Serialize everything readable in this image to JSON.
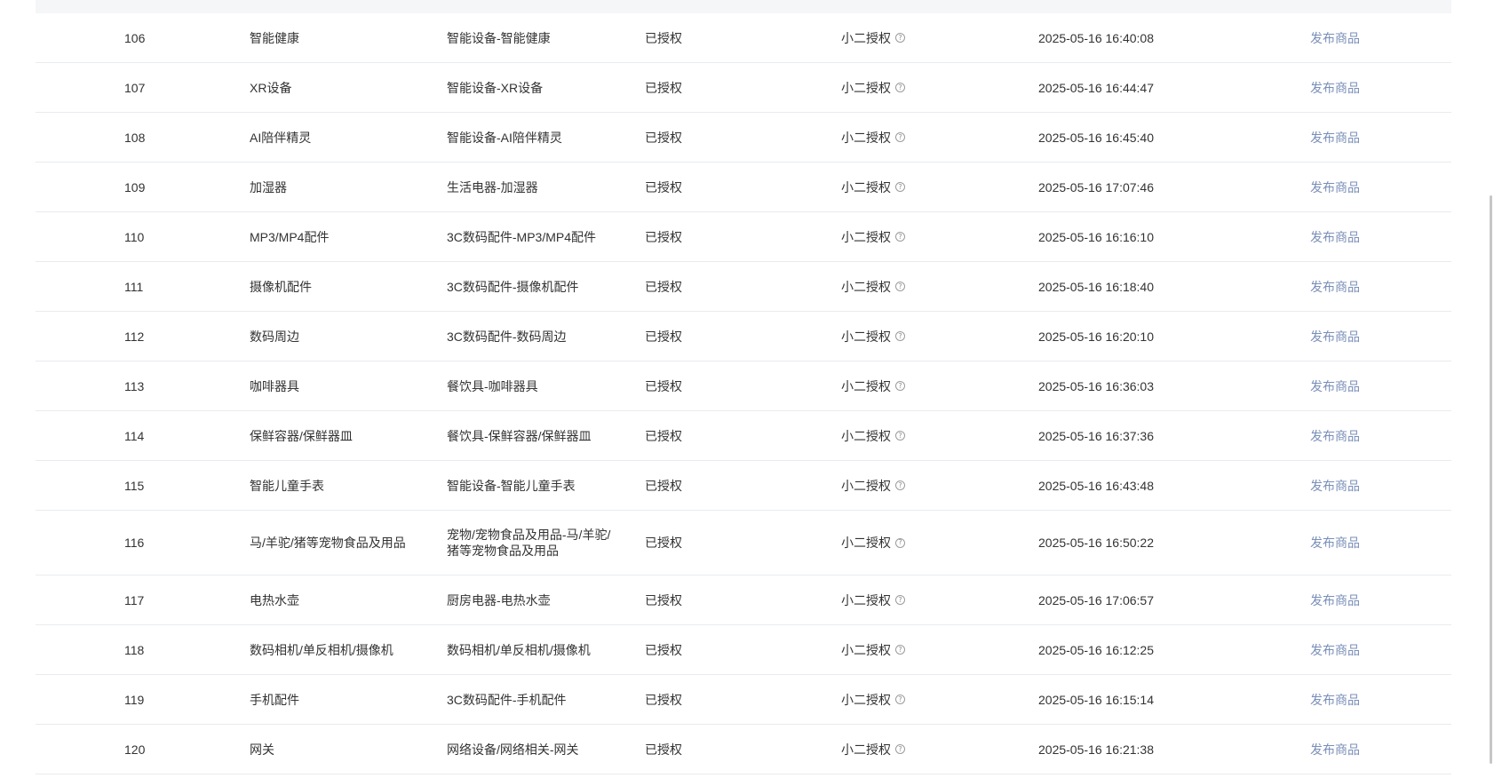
{
  "rows": [
    {
      "id": "106",
      "name": "智能健康",
      "path": "智能设备-智能健康",
      "status": "已授权",
      "auth_type": "小二授权",
      "time": "2025-05-16 16:40:08",
      "action": "发布商品"
    },
    {
      "id": "107",
      "name": "XR设备",
      "path": "智能设备-XR设备",
      "status": "已授权",
      "auth_type": "小二授权",
      "time": "2025-05-16 16:44:47",
      "action": "发布商品"
    },
    {
      "id": "108",
      "name": "AI陪伴精灵",
      "path": "智能设备-AI陪伴精灵",
      "status": "已授权",
      "auth_type": "小二授权",
      "time": "2025-05-16 16:45:40",
      "action": "发布商品"
    },
    {
      "id": "109",
      "name": "加湿器",
      "path": "生活电器-加湿器",
      "status": "已授权",
      "auth_type": "小二授权",
      "time": "2025-05-16 17:07:46",
      "action": "发布商品"
    },
    {
      "id": "110",
      "name": "MP3/MP4配件",
      "path": "3C数码配件-MP3/MP4配件",
      "status": "已授权",
      "auth_type": "小二授权",
      "time": "2025-05-16 16:16:10",
      "action": "发布商品"
    },
    {
      "id": "111",
      "name": "摄像机配件",
      "path": "3C数码配件-摄像机配件",
      "status": "已授权",
      "auth_type": "小二授权",
      "time": "2025-05-16 16:18:40",
      "action": "发布商品"
    },
    {
      "id": "112",
      "name": "数码周边",
      "path": "3C数码配件-数码周边",
      "status": "已授权",
      "auth_type": "小二授权",
      "time": "2025-05-16 16:20:10",
      "action": "发布商品"
    },
    {
      "id": "113",
      "name": "咖啡器具",
      "path": "餐饮具-咖啡器具",
      "status": "已授权",
      "auth_type": "小二授权",
      "time": "2025-05-16 16:36:03",
      "action": "发布商品"
    },
    {
      "id": "114",
      "name": "保鲜容器/保鲜器皿",
      "path": "餐饮具-保鲜容器/保鲜器皿",
      "status": "已授权",
      "auth_type": "小二授权",
      "time": "2025-05-16 16:37:36",
      "action": "发布商品"
    },
    {
      "id": "115",
      "name": "智能儿童手表",
      "path": "智能设备-智能儿童手表",
      "status": "已授权",
      "auth_type": "小二授权",
      "time": "2025-05-16 16:43:48",
      "action": "发布商品"
    },
    {
      "id": "116",
      "name": "马/羊驼/猪等宠物食品及用品",
      "path": "宠物/宠物食品及用品-马/羊驼/猪等宠物食品及用品",
      "status": "已授权",
      "auth_type": "小二授权",
      "time": "2025-05-16 16:50:22",
      "action": "发布商品"
    },
    {
      "id": "117",
      "name": "电热水壶",
      "path": "厨房电器-电热水壶",
      "status": "已授权",
      "auth_type": "小二授权",
      "time": "2025-05-16 17:06:57",
      "action": "发布商品"
    },
    {
      "id": "118",
      "name": "数码相机/单反相机/摄像机",
      "path": "数码相机/单反相机/摄像机",
      "status": "已授权",
      "auth_type": "小二授权",
      "time": "2025-05-16 16:12:25",
      "action": "发布商品"
    },
    {
      "id": "119",
      "name": "手机配件",
      "path": "3C数码配件-手机配件",
      "status": "已授权",
      "auth_type": "小二授权",
      "time": "2025-05-16 16:15:14",
      "action": "发布商品"
    },
    {
      "id": "120",
      "name": "网关",
      "path": "网络设备/网络相关-网关",
      "status": "已授权",
      "auth_type": "小二授权",
      "time": "2025-05-16 16:21:38",
      "action": "发布商品"
    }
  ],
  "icons": {
    "help": "question-circle-icon"
  },
  "colors": {
    "action_link": "#7a8fb8",
    "row_border": "#e9ebef",
    "text": "#333333"
  }
}
